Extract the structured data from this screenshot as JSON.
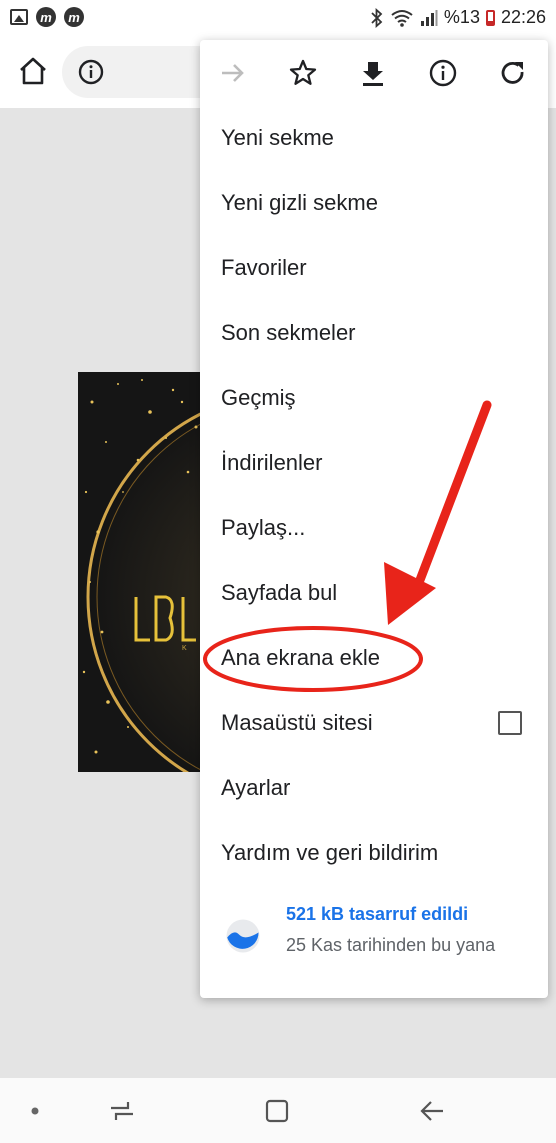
{
  "status_bar": {
    "left_icons": [
      "image-icon",
      "m-app-icon",
      "m-app-icon"
    ],
    "app_icon_letter": "m",
    "battery_percent": "%13",
    "time": "22:26",
    "icons": [
      "bluetooth-icon",
      "wifi-icon",
      "signal-icon",
      "battery-icon"
    ]
  },
  "toolbar": {
    "icons": [
      "home-icon",
      "info-icon"
    ]
  },
  "menu": {
    "top_icons": [
      "forward-icon",
      "bookmark-star-icon",
      "download-icon",
      "page-info-icon",
      "reload-icon"
    ],
    "items": [
      {
        "label": "Yeni sekme"
      },
      {
        "label": "Yeni gizli sekme"
      },
      {
        "label": "Favoriler"
      },
      {
        "label": "Son sekmeler"
      },
      {
        "label": "Geçmiş"
      },
      {
        "label": "İndirilenler"
      },
      {
        "label": "Paylaş..."
      },
      {
        "label": "Sayfada bul"
      },
      {
        "label": "Ana ekrana ekle"
      },
      {
        "label": "Masaüstü sitesi",
        "checked": false
      },
      {
        "label": "Ayarlar"
      },
      {
        "label": "Yardım ve geri bildirim"
      }
    ],
    "savings": {
      "title": "521 kB tasarruf edildi",
      "subtitle": "25 Kas tarihinden bu yana"
    }
  },
  "annotation": {
    "highlight": "Ana ekrana ekle",
    "color": "#e8241a"
  },
  "navbar": {
    "icons": [
      "dot-icon",
      "recent-apps-icon",
      "home-square-icon",
      "back-arrow-icon"
    ]
  },
  "colors": {
    "accent": "#1a73e8",
    "annotation": "#e8241a",
    "page_background": "#e4e4e4"
  }
}
